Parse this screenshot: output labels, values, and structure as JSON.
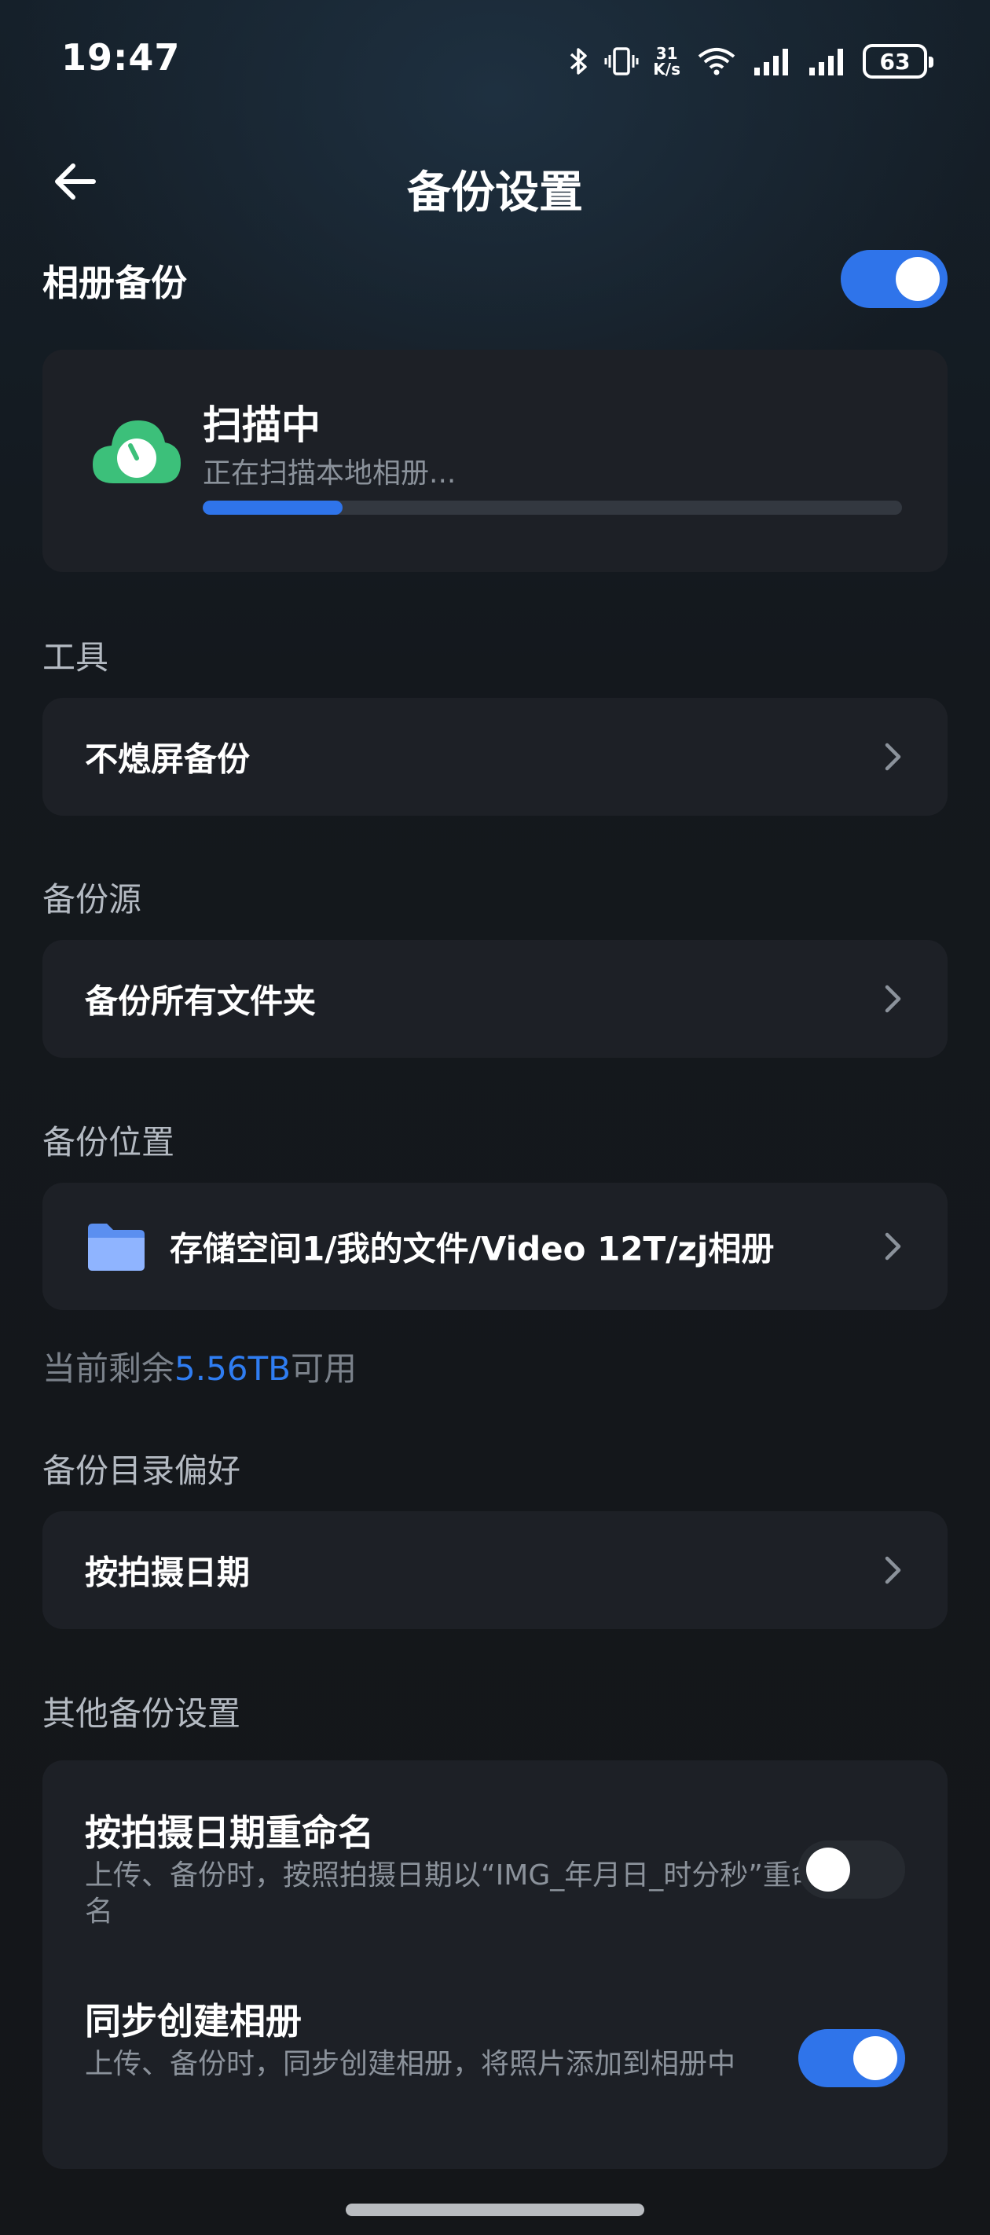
{
  "status": {
    "time": "19:47",
    "speed_value": "31",
    "speed_unit": "K/s",
    "battery": "63"
  },
  "header": {
    "title": "备份设置"
  },
  "album_backup": {
    "label": "相册备份",
    "enabled": true
  },
  "scan": {
    "title": "扫描中",
    "subtitle": "正在扫描本地相册...",
    "progress": 0.2
  },
  "sections": {
    "tools": {
      "label": "工具",
      "item": "不熄屏备份"
    },
    "source": {
      "label": "备份源",
      "item": "备份所有文件夹"
    },
    "location": {
      "label": "备份位置",
      "path": "存储空间1/我的文件/Video 12T/zj相册"
    },
    "free": {
      "prefix": "当前剩余",
      "value": "5.56TB",
      "suffix": "可用"
    },
    "dir_pref": {
      "label": "备份目录偏好",
      "item": "按拍摄日期"
    },
    "other": {
      "label": "其他备份设置",
      "options": [
        {
          "title": "按拍摄日期重命名",
          "desc": "上传、备份时，按照拍摄日期以“IMG_年月日_时分秒”重命名",
          "enabled": false
        },
        {
          "title": "同步创建相册",
          "desc": "上传、备份时，同步创建相册，将照片添加到相册中",
          "enabled": true
        }
      ]
    }
  },
  "colors": {
    "accent": "#2f74ea",
    "cloud_green": "#3cc07a",
    "card_bg": "#1d2026"
  },
  "icons": {
    "back": "arrow-left-icon",
    "cloud": "cloud-icon",
    "folder": "folder-icon",
    "chevron": "chevron-right-icon",
    "bluetooth": "bluetooth-icon",
    "vibrate": "vibrate-icon",
    "wifi": "wifi-icon",
    "signal": "signal-icon"
  }
}
